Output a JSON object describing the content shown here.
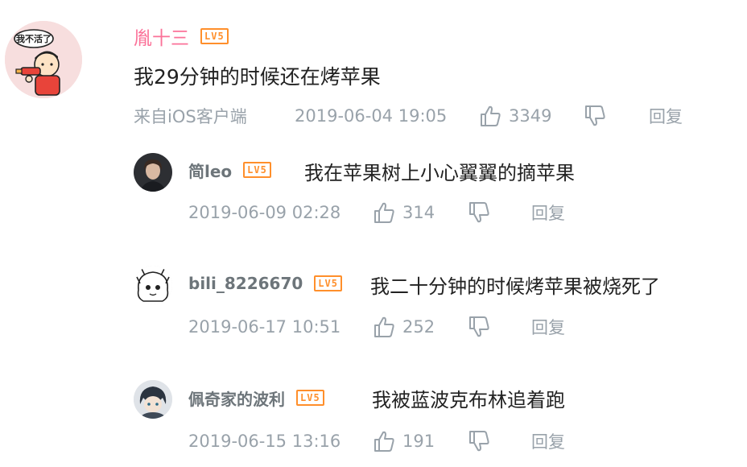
{
  "main_comment": {
    "username": "胤十三",
    "level": "LV5",
    "avatar_caption": "我不活了",
    "text": "我29分钟的时候还在烤苹果",
    "source": "来自iOS客户端",
    "time": "2019-06-04 19:05",
    "likes": "3349",
    "reply_label": "回复",
    "username_color": "#fb7299"
  },
  "replies": [
    {
      "username": "简leo",
      "level": "LV5",
      "text": "我在苹果树上小心翼翼的摘苹果",
      "time": "2019-06-09 02:28",
      "likes": "314",
      "reply_label": "回复"
    },
    {
      "username": "bili_8226670",
      "level": "LV5",
      "text": "我二十分钟的时候烤苹果被烧死了",
      "time": "2019-06-17 10:51",
      "likes": "252",
      "reply_label": "回复"
    },
    {
      "username": "佩奇家的波利",
      "level": "LV5",
      "text": "我被蓝波克布林追着跑",
      "time": "2019-06-15 13:16",
      "likes": "191",
      "reply_label": "回复"
    }
  ],
  "icons": {
    "like": "thumbs-up-icon",
    "dislike": "thumbs-down-icon"
  },
  "colors": {
    "level_badge": "#ff8f2b",
    "meta_text": "#99a2aa",
    "reply_username": "#6d757a"
  }
}
